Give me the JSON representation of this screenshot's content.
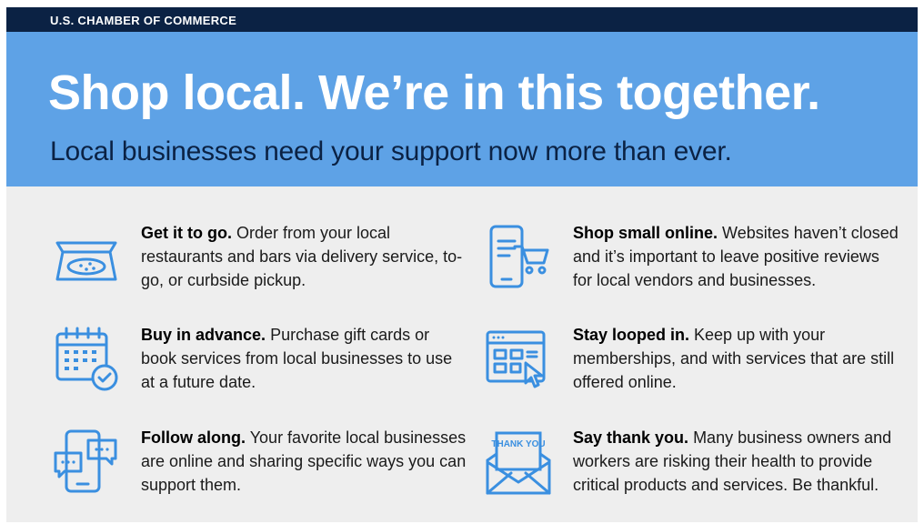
{
  "header": {
    "org": "U.S. CHAMBER OF COMMERCE",
    "headline": "Shop local. We’re in this together.",
    "subheadline": "Local businesses need your support now more than ever."
  },
  "colors": {
    "topbar": "#0b2244",
    "hero": "#5ea2e6",
    "icon": "#3a8fe0",
    "background": "#eeeeee"
  },
  "tips": [
    {
      "icon": "pizza-box-icon",
      "title": "Get it to go.",
      "body": "Order from your local restaurants and bars via delivery service, to-go, or curbside pickup."
    },
    {
      "icon": "phone-cart-icon",
      "title": "Shop small online.",
      "body": "Websites haven’t closed and it’s important to leave positive reviews for local vendors and businesses."
    },
    {
      "icon": "calendar-check-icon",
      "title": "Buy in advance.",
      "body": "Purchase gift cards or book services from local businesses to use at a future date."
    },
    {
      "icon": "browser-cursor-icon",
      "title": "Stay looped in.",
      "body": "Keep up with your memberships, and with services that are still offered online."
    },
    {
      "icon": "chat-phone-icon",
      "title": "Follow along.",
      "body": "Your favorite local businesses are online and sharing specific ways you can support them."
    },
    {
      "icon": "thank-you-envelope-icon",
      "title": "Say thank you.",
      "body": "Many business owners and workers are risking their health to provide critical products and services. Be thankful.",
      "icon_text": "THANK YOU"
    }
  ]
}
